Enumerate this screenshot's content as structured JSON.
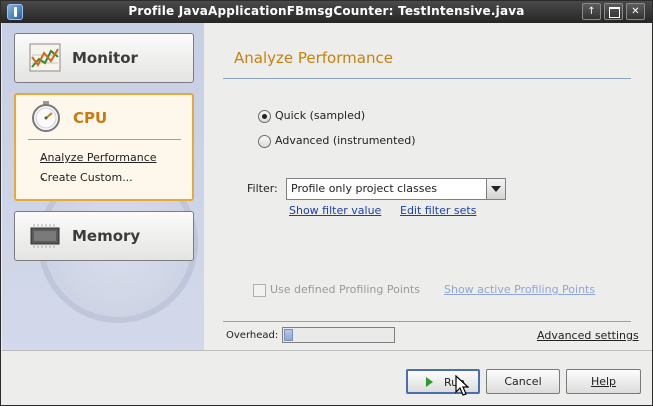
{
  "window": {
    "title": "Profile JavaApplicationFBmsgCounter: TestIntensive.java",
    "buttons": [
      "window-up",
      "maximize",
      "close"
    ]
  },
  "sidebar": {
    "categories": [
      {
        "label": "Monitor",
        "icon": "monitor-chart-icon"
      },
      {
        "label": "CPU",
        "icon": "stopwatch-icon",
        "selected": true,
        "subitems": [
          {
            "label": "Analyze Performance",
            "selected": true
          },
          {
            "label": "Create Custom..."
          }
        ]
      },
      {
        "label": "Memory",
        "icon": "memory-chip-icon"
      }
    ]
  },
  "main": {
    "heading": "Analyze Performance",
    "modes": [
      {
        "label": "Quick (sampled)",
        "checked": true
      },
      {
        "label": "Advanced (instrumented)",
        "checked": false
      }
    ],
    "filter": {
      "label": "Filter:",
      "selected": "Profile only project classes",
      "show_link": "Show filter value",
      "edit_link": "Edit filter sets"
    },
    "profiling_points": {
      "checkbox_label": "Use defined Profiling Points",
      "checked": false,
      "enabled": false,
      "link": "Show active Profiling Points"
    },
    "overhead": {
      "label": "Overhead:",
      "level": 0.08
    },
    "advanced_link": "Advanced settings"
  },
  "footer": {
    "run": "Run",
    "cancel": "Cancel",
    "help": "Help"
  },
  "colors": {
    "accent": "#c6820e",
    "selection_border": "#e8a83a",
    "link": "#1a3fa8",
    "titlebar": "#2c2c2c",
    "sidebar_bg": "#cdd3e5"
  }
}
